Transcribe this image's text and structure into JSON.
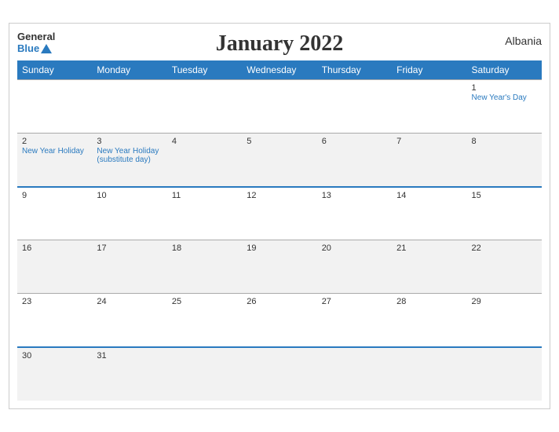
{
  "header": {
    "logo_general": "General",
    "logo_blue": "Blue",
    "month_title": "January 2022",
    "country": "Albania"
  },
  "weekdays": [
    "Sunday",
    "Monday",
    "Tuesday",
    "Wednesday",
    "Thursday",
    "Friday",
    "Saturday"
  ],
  "weeks": [
    {
      "days": [
        {
          "num": "",
          "holiday": ""
        },
        {
          "num": "",
          "holiday": ""
        },
        {
          "num": "",
          "holiday": ""
        },
        {
          "num": "",
          "holiday": ""
        },
        {
          "num": "",
          "holiday": ""
        },
        {
          "num": "",
          "holiday": ""
        },
        {
          "num": "1",
          "holiday": "New Year's Day"
        }
      ],
      "class": "week1",
      "blue_top": false
    },
    {
      "days": [
        {
          "num": "2",
          "holiday": "New Year Holiday"
        },
        {
          "num": "3",
          "holiday": "New Year Holiday (substitute day)"
        },
        {
          "num": "4",
          "holiday": ""
        },
        {
          "num": "5",
          "holiday": ""
        },
        {
          "num": "6",
          "holiday": ""
        },
        {
          "num": "7",
          "holiday": ""
        },
        {
          "num": "8",
          "holiday": ""
        }
      ],
      "class": "week2",
      "blue_top": false
    },
    {
      "days": [
        {
          "num": "9",
          "holiday": ""
        },
        {
          "num": "10",
          "holiday": ""
        },
        {
          "num": "11",
          "holiday": ""
        },
        {
          "num": "12",
          "holiday": ""
        },
        {
          "num": "13",
          "holiday": ""
        },
        {
          "num": "14",
          "holiday": ""
        },
        {
          "num": "15",
          "holiday": ""
        }
      ],
      "class": "week3",
      "blue_top": true
    },
    {
      "days": [
        {
          "num": "16",
          "holiday": ""
        },
        {
          "num": "17",
          "holiday": ""
        },
        {
          "num": "18",
          "holiday": ""
        },
        {
          "num": "19",
          "holiday": ""
        },
        {
          "num": "20",
          "holiday": ""
        },
        {
          "num": "21",
          "holiday": ""
        },
        {
          "num": "22",
          "holiday": ""
        }
      ],
      "class": "week4",
      "blue_top": false
    },
    {
      "days": [
        {
          "num": "23",
          "holiday": ""
        },
        {
          "num": "24",
          "holiday": ""
        },
        {
          "num": "25",
          "holiday": ""
        },
        {
          "num": "26",
          "holiday": ""
        },
        {
          "num": "27",
          "holiday": ""
        },
        {
          "num": "28",
          "holiday": ""
        },
        {
          "num": "29",
          "holiday": ""
        }
      ],
      "class": "week5",
      "blue_top": false
    },
    {
      "days": [
        {
          "num": "30",
          "holiday": ""
        },
        {
          "num": "31",
          "holiday": ""
        },
        {
          "num": "",
          "holiday": ""
        },
        {
          "num": "",
          "holiday": ""
        },
        {
          "num": "",
          "holiday": ""
        },
        {
          "num": "",
          "holiday": ""
        },
        {
          "num": "",
          "holiday": ""
        }
      ],
      "class": "week6",
      "blue_top": true
    }
  ]
}
